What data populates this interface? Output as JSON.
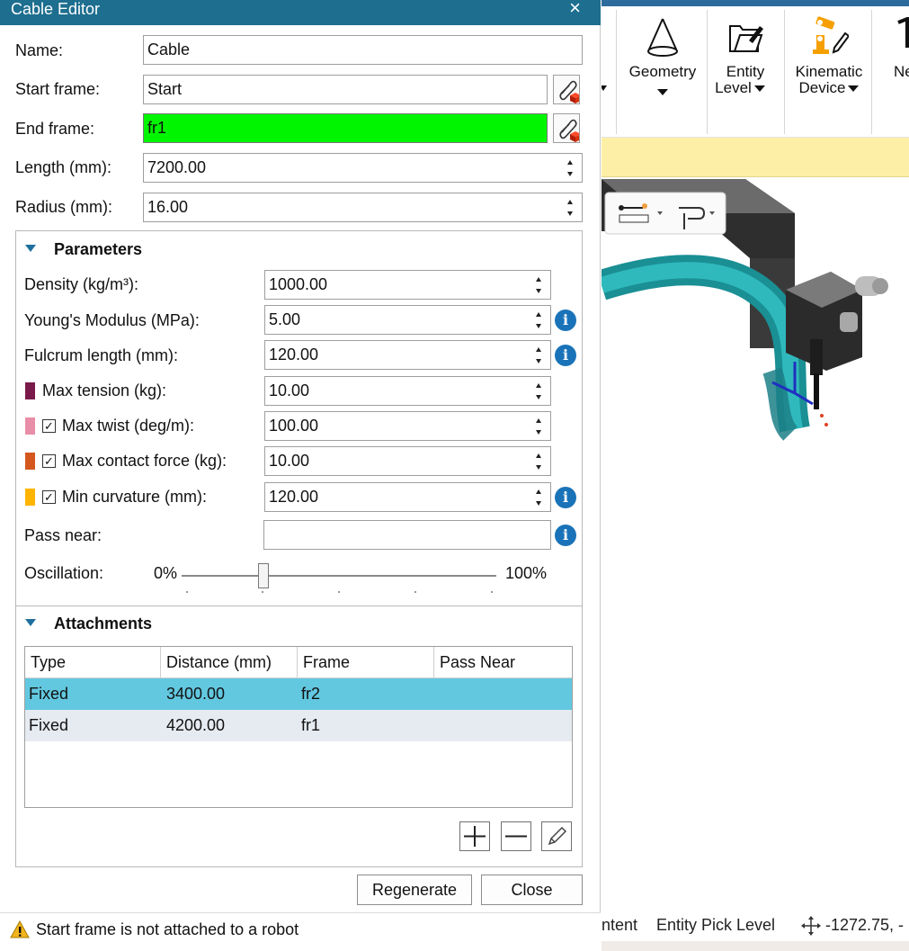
{
  "dialog": {
    "title": "Cable Editor",
    "close_glyph": "×",
    "fields": {
      "name": {
        "label": "Name:",
        "value": "Cable"
      },
      "start_frame": {
        "label": "Start frame:",
        "value": "Start"
      },
      "end_frame": {
        "label": "End frame:",
        "value": "fr1",
        "highlight_color": "#00f500"
      },
      "length": {
        "label": "Length (mm):",
        "value": "7200.00"
      },
      "radius": {
        "label": "Radius (mm):",
        "value": "16.00"
      }
    },
    "parameters": {
      "header": "Parameters",
      "density": {
        "label": "Density (kg/m³):",
        "value": "1000.00"
      },
      "youngs": {
        "label": "Young's Modulus (MPa):",
        "value": "5.00"
      },
      "fulcrum": {
        "label": "Fulcrum length (mm):",
        "value": "120.00"
      },
      "max_tension": {
        "label": "Max tension (kg):",
        "value": "10.00",
        "color": "#7a1a4a"
      },
      "max_twist": {
        "label": "Max twist (deg/m):",
        "value": "100.00",
        "color": "#e88ea8",
        "checked": true
      },
      "max_contact": {
        "label": "Max contact force (kg):",
        "value": "10.00",
        "color": "#d4581e",
        "checked": true
      },
      "min_curvature": {
        "label": "Min curvature (mm):",
        "value": "120.00",
        "color": "#ffb400",
        "checked": true
      },
      "pass_near": {
        "label": "Pass near:",
        "value": ""
      },
      "oscillation": {
        "label": "Oscillation:",
        "min_label": "0%",
        "max_label": "100%",
        "value_fraction": 0.25
      }
    },
    "attachments": {
      "header": "Attachments",
      "columns": [
        "Type",
        "Distance (mm)",
        "Frame",
        "Pass Near"
      ],
      "rows": [
        {
          "type": "Fixed",
          "distance": "3400.00",
          "frame": "fr2",
          "pass_near": "",
          "selected": true
        },
        {
          "type": "Fixed",
          "distance": "4200.00",
          "frame": "fr1",
          "pass_near": "",
          "selected": false
        }
      ],
      "selected_color": "#62c8e0"
    },
    "buttons": {
      "regenerate": "Regenerate",
      "close": "Close"
    },
    "status": {
      "icon": "warning-icon",
      "text": "Start frame is not attached to a robot"
    }
  },
  "ribbon": {
    "groups": [
      {
        "label1": "Geometry",
        "label2": "",
        "icon": "cone-icon"
      },
      {
        "label1": "Entity",
        "label2": "Level",
        "icon": "folder-pen-icon"
      },
      {
        "label1": "Kinematic",
        "label2": "Device",
        "icon": "robot-arm-icon"
      },
      {
        "label1": "Ne",
        "label2": "",
        "icon": "new-icon"
      }
    ]
  },
  "app_status": {
    "left": "ntent",
    "pick_level": "Entity Pick Level",
    "coords": "-1272.75, -"
  }
}
